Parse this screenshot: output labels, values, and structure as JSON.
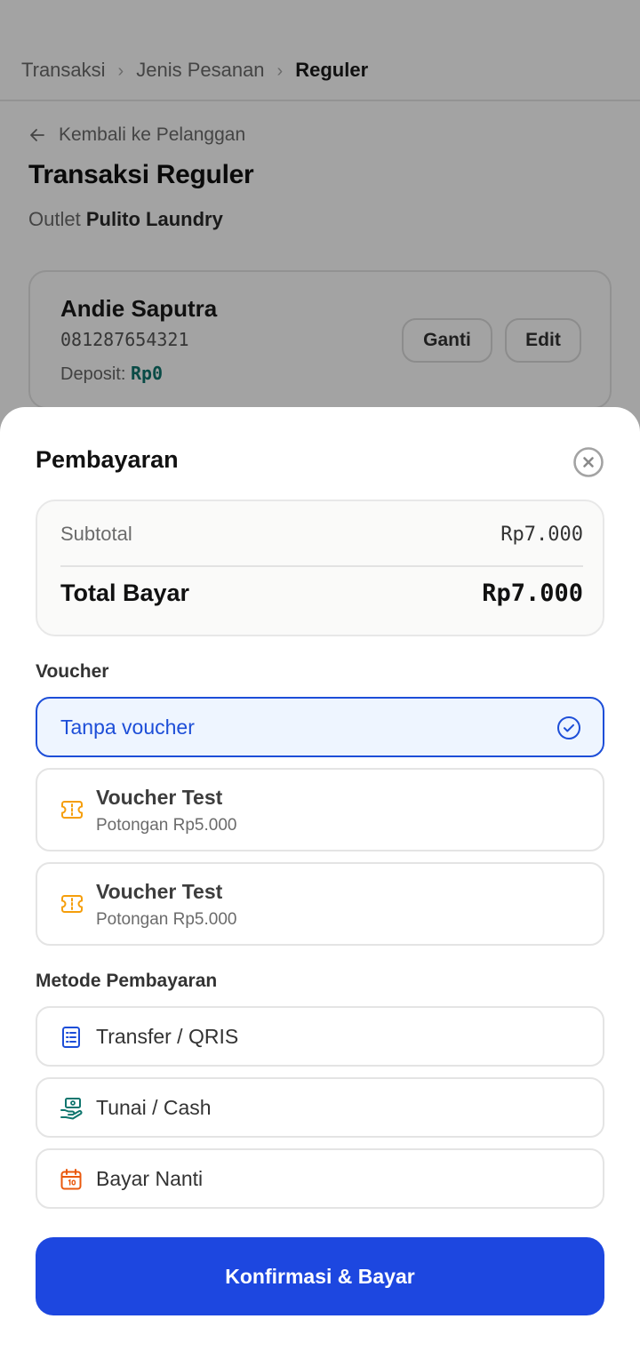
{
  "breadcrumb": {
    "items": [
      "Transaksi",
      "Jenis Pesanan",
      "Reguler"
    ]
  },
  "page": {
    "back_label": "Kembali ke Pelanggan",
    "title": "Transaksi Reguler",
    "outlet_prefix": "Outlet",
    "outlet_name": "Pulito Laundry"
  },
  "customer": {
    "name": "Andie Saputra",
    "phone": "081287654321",
    "deposit_label": "Deposit:",
    "deposit_value": "Rp0",
    "change_label": "Ganti",
    "edit_label": "Edit"
  },
  "sheet": {
    "title": "Pembayaran",
    "subtotal_label": "Subtotal",
    "subtotal_value": "Rp7.000",
    "total_label": "Total Bayar",
    "total_value": "Rp7.000",
    "voucher_section": "Voucher",
    "no_voucher_label": "Tanpa voucher",
    "vouchers": [
      {
        "title": "Voucher Test",
        "subtitle": "Potongan Rp5.000"
      },
      {
        "title": "Voucher Test",
        "subtitle": "Potongan Rp5.000"
      }
    ],
    "method_section": "Metode Pembayaran",
    "methods": [
      {
        "label": "Transfer / QRIS",
        "icon": "receipt-icon"
      },
      {
        "label": "Tunai / Cash",
        "icon": "cash-hand-icon"
      },
      {
        "label": "Bayar Nanti",
        "icon": "calendar-icon"
      }
    ],
    "confirm_label": "Konfirmasi & Bayar"
  },
  "colors": {
    "primary": "#1d47e0",
    "selected_border": "#1d4ed8",
    "deposit": "#0f766e",
    "voucher_icon": "#f59e0b",
    "cash_icon": "#0f766e",
    "calendar_icon": "#ea580c"
  }
}
